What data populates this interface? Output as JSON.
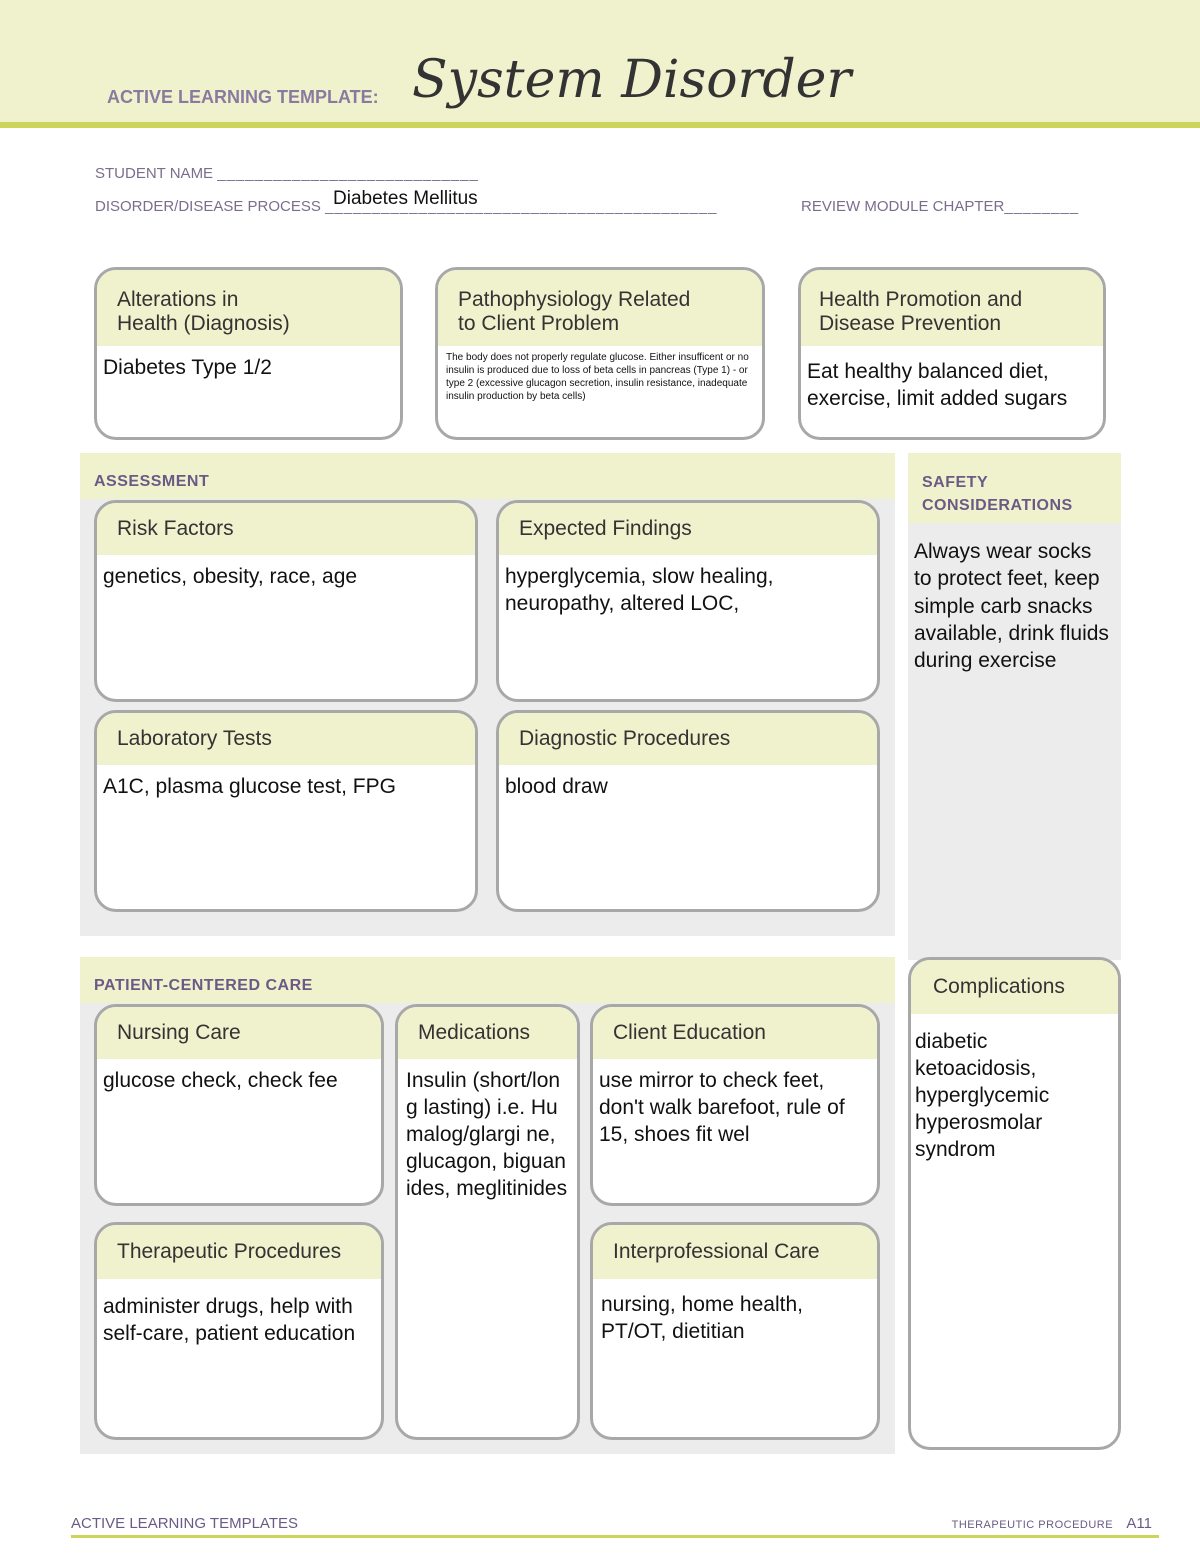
{
  "header": {
    "template_label": "ACTIVE LEARNING TEMPLATE:",
    "title": "System Disorder"
  },
  "meta": {
    "student_name_label": "STUDENT NAME",
    "student_name_blank": "____________________________",
    "disorder_label": "DISORDER/DISEASE PROCESS",
    "disorder_blank": "__________________________________________",
    "disorder_value": "Diabetes Mellitus",
    "review_label": "REVIEW MODULE CHAPTER",
    "review_blank": "________"
  },
  "top_boxes": {
    "alterations": {
      "title_line1": "Alterations in",
      "title_line2": "Health (Diagnosis)",
      "content": "Diabetes Type 1/2"
    },
    "pathophysiology": {
      "title_line1": "Pathophysiology Related",
      "title_line2": "to Client Problem",
      "content": "The body does not properly regulate glucose. Either insufficent or no insulin is produced due to loss of beta cells in pancreas (Type 1) - or type 2 (excessive glucagon secretion, insulin resistance, inadequate insulin production by beta cells)"
    },
    "health_promotion": {
      "title_line1": "Health Promotion and",
      "title_line2": "Disease Prevention",
      "content": "Eat healthy balanced diet, exercise, limit added sugars"
    }
  },
  "assessment": {
    "section_label": "ASSESSMENT",
    "risk_factors": {
      "title": "Risk Factors",
      "content": "genetics, obesity, race, age"
    },
    "expected_findings": {
      "title": "Expected Findings",
      "content": "hyperglycemia, slow healing, neuropathy, altered LOC,"
    },
    "laboratory_tests": {
      "title": "Laboratory Tests",
      "content": "A1C, plasma glucose test, FPG"
    },
    "diagnostic_procedures": {
      "title": "Diagnostic Procedures",
      "content": "blood draw"
    }
  },
  "safety": {
    "section_label_line1": "SAFETY",
    "section_label_line2": "CONSIDERATIONS",
    "content": "Always wear socks to protect feet, keep simple carb snacks available, drink fluids during exercise"
  },
  "patient_centered_care": {
    "section_label": "PATIENT-CENTERED CARE",
    "nursing_care": {
      "title": "Nursing Care",
      "content": "glucose check, check fee"
    },
    "medications": {
      "title": "Medications",
      "content": "Insulin (short/long lasting) i.e. Humalog/glargi ne, glucagon, biguanides, meglitinides"
    },
    "client_education": {
      "title": "Client Education",
      "content": "use mirror to check feet, don't walk barefoot, rule of 15, shoes fit wel"
    },
    "therapeutic_procedures": {
      "title": "Therapeutic Procedures",
      "content": "administer drugs, help with self-care, patient education"
    },
    "interprofessional_care": {
      "title": "Interprofessional Care",
      "content": "nursing, home health, PT/OT, dietitian"
    }
  },
  "complications": {
    "title": "Complications",
    "content": "diabetic ketoacidosis, hyperglycemic hyperosmolar syndrom"
  },
  "footer": {
    "left": "ACTIVE LEARNING TEMPLATES",
    "right_label": "THERAPEUTIC PROCEDURE",
    "page": "A11"
  },
  "colors": {
    "header_band": "#f0f2cd",
    "accent_rule": "#cdd45a",
    "section_label": "#6b5a86",
    "panel_bg": "#ececec",
    "box_border": "#a8a8a8"
  }
}
